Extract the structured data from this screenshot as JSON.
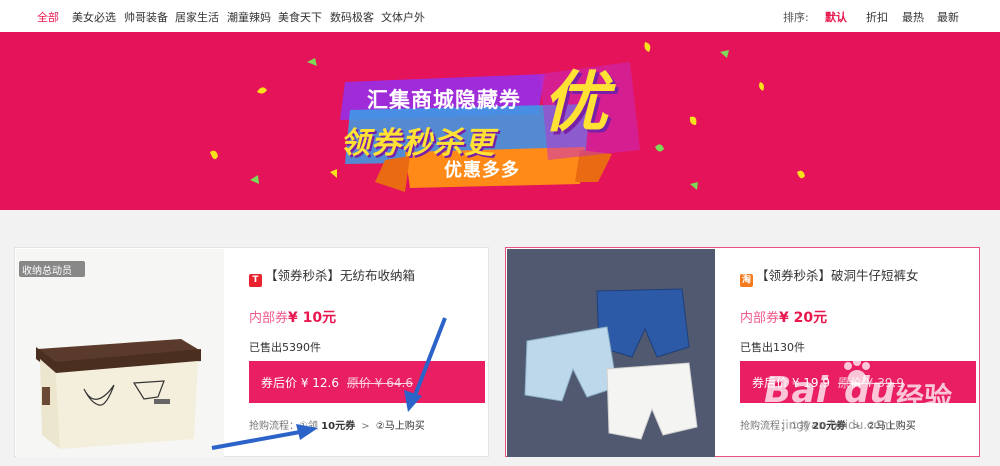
{
  "nav": {
    "categories": [
      "全部",
      "美女必选",
      "帅哥装备",
      "居家生活",
      "潮童辣妈",
      "美食天下",
      "数码极客",
      "文体户外"
    ],
    "sort_label": "排序:",
    "sort_options": [
      "默认",
      "折扣",
      "最热",
      "最新"
    ]
  },
  "banner": {
    "line1": "汇集商城隐藏券",
    "line2": "领券秒杀更",
    "big_char": "优",
    "ribbon": "优惠多多"
  },
  "products": [
    {
      "badge": "T",
      "badge_color": "#e8232d",
      "title": "【领券秒杀】无纺布收纳箱",
      "coupon_label": "内部券",
      "coupon_value": "¥ 10元",
      "sold": "已售出5390件",
      "after_price": "券后价 ¥ 12.6",
      "orig_price": "原价 ¥ 64.6",
      "flow_label": "抢购流程：",
      "step1_prefix": "①领",
      "step1_amount": "10元券",
      "step2": "②马上购买",
      "image_tag": "收纳总动员"
    },
    {
      "badge": "淘",
      "badge_color": "#f57b1f",
      "title": "【领券秒杀】破洞牛仔短裤女",
      "coupon_label": "内部券",
      "coupon_value": "¥ 20元",
      "sold": "已售出130件",
      "after_price": "券后价 ¥ 19.9",
      "orig_price": "原价 ¥ 39.9",
      "flow_label": "抢购流程：",
      "step1_prefix": "①领",
      "step1_amount": "20元券",
      "step2": "②马上购买"
    }
  ],
  "watermark": {
    "brand": "Bai",
    "paw": "du",
    "cn": "经验",
    "url": "jingyan.baidu.com"
  }
}
